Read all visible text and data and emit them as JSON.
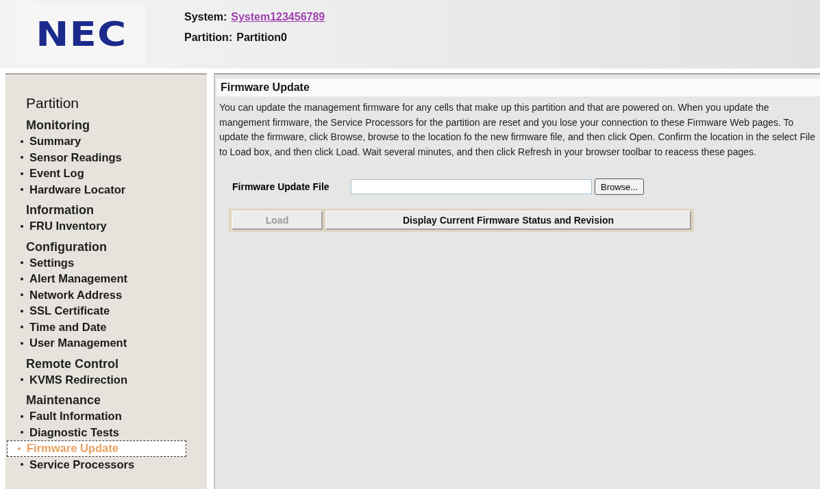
{
  "header": {
    "logo": "NEC",
    "system_label": "System:",
    "system_link": "System123456789",
    "partition_label": "Partition:",
    "partition_value": "Partition0"
  },
  "sidebar": {
    "title": "Partition",
    "sections": [
      {
        "heading": "Monitoring",
        "items": [
          {
            "label": "Summary",
            "selected": false
          },
          {
            "label": "Sensor Readings",
            "selected": false
          },
          {
            "label": "Event Log",
            "selected": false
          },
          {
            "label": "Hardware Locator",
            "selected": false
          }
        ]
      },
      {
        "heading": "Information",
        "items": [
          {
            "label": "FRU Inventory",
            "selected": false
          }
        ]
      },
      {
        "heading": "Configuration",
        "items": [
          {
            "label": "Settings",
            "selected": false
          },
          {
            "label": "Alert Management",
            "selected": false
          },
          {
            "label": "Network Address",
            "selected": false
          },
          {
            "label": "SSL Certificate",
            "selected": false
          },
          {
            "label": "Time and Date",
            "selected": false
          },
          {
            "label": "User Management",
            "selected": false
          }
        ]
      },
      {
        "heading": "Remote Control",
        "items": [
          {
            "label": "KVMS Redirection",
            "selected": false
          }
        ]
      },
      {
        "heading": "Maintenance",
        "items": [
          {
            "label": "Fault Information",
            "selected": false
          },
          {
            "label": "Diagnostic Tests",
            "selected": false
          },
          {
            "label": "Firmware Update",
            "selected": true
          },
          {
            "label": "Service Processors",
            "selected": false
          }
        ]
      }
    ]
  },
  "main": {
    "title": "Firmware Update",
    "description": "You can update the management firmware for any cells that make up this partition and that are powered on. When you update the mangement firmware, the Service Processors for the partition are reset and you lose your connection to these Firmware Web pages. To update the firmware, click Browse, browse to the location fo the new firmware file, and then click Open. Confirm the location in the select File to Load box, and then click Load. Wait several minutes, and then click Refresh in your browser toolbar to reacess these pages.",
    "file_label": "Firmware Update File",
    "browse_button": "Browse...",
    "buttons": [
      {
        "label": "Load",
        "disabled": true
      },
      {
        "label": "Display Current Firmware Status and Revision",
        "disabled": false
      }
    ]
  }
}
